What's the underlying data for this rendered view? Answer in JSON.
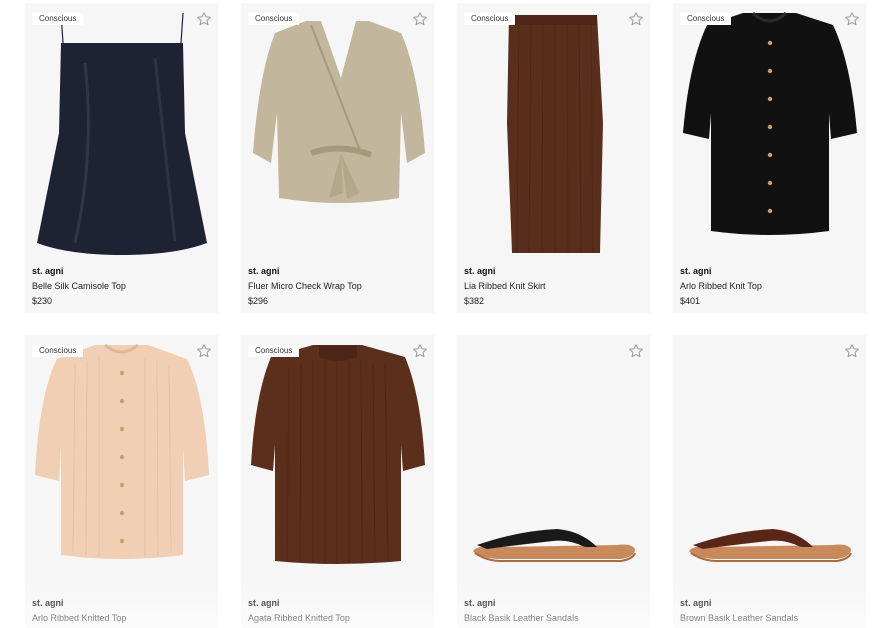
{
  "colors": {
    "card_bg": "#f6f6f6",
    "badge_bg": "#ffffff",
    "star": "#9a9a9a"
  },
  "products": [
    {
      "badge": "Conscious",
      "brand": "st. agni",
      "name": "Belle Silk Camisole Top",
      "price": "$230",
      "image_icon": "camisole-top-icon",
      "color": "#1e2333"
    },
    {
      "badge": "Conscious",
      "brand": "st. agni",
      "name": "Fluer Micro Check Wrap Top",
      "price": "$296",
      "image_icon": "wrap-top-icon",
      "color": "#c2b79c"
    },
    {
      "badge": "Conscious",
      "brand": "st. agni",
      "name": "Lia Ribbed Knit Skirt",
      "price": "$382",
      "image_icon": "pencil-skirt-icon",
      "color": "#5a2e1d"
    },
    {
      "badge": "Conscious",
      "brand": "st. agni",
      "name": "Arlo Ribbed Knit Top",
      "price": "$401",
      "image_icon": "cardigan-top-icon",
      "color": "#111111"
    },
    {
      "badge": "Conscious",
      "brand": "st. agni",
      "name": "Arlo Ribbed Knitted Top",
      "price": "",
      "image_icon": "cardigan-top-icon",
      "color": "#f1cfb4"
    },
    {
      "badge": "Conscious",
      "brand": "st. agni",
      "name": "Agata Ribbed Knitted Top",
      "price": "",
      "image_icon": "knit-tee-icon",
      "color": "#5b2f1c"
    },
    {
      "badge": "",
      "brand": "st. agni",
      "name": "Black Basik Leather Sandals",
      "price": "",
      "image_icon": "sandal-icon",
      "color": "#1a1a1a"
    },
    {
      "badge": "",
      "brand": "st. agni",
      "name": "Brown Basik Leather Sandals",
      "price": "",
      "image_icon": "sandal-icon",
      "color": "#5a2618"
    }
  ]
}
